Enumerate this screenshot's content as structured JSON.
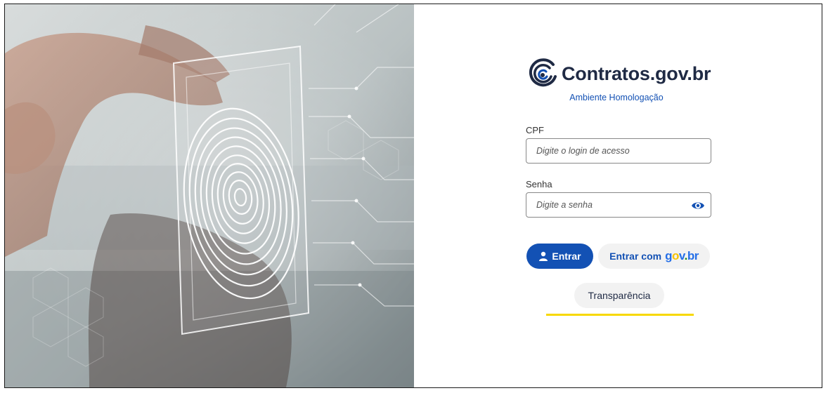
{
  "brand": {
    "name": "Contratos.gov.br",
    "environment": "Ambiente Homologação"
  },
  "form": {
    "cpf": {
      "label": "CPF",
      "placeholder": "Digite o login de acesso",
      "value": ""
    },
    "senha": {
      "label": "Senha",
      "placeholder": "Digite a senha",
      "value": ""
    }
  },
  "actions": {
    "entrar_label": "Entrar",
    "govbr_prefix": "Entrar com",
    "govbr_logo": {
      "g": "g",
      "o": "o",
      "v": "v",
      "dot": ".",
      "br": "br"
    },
    "transparencia_label": "Transparência"
  },
  "colors": {
    "primary": "#1351b4",
    "brand_dark": "#1f2a44",
    "accent_yellow": "#f8d800",
    "govbr_blue": "#2670e8",
    "govbr_yellow": "#f8c300",
    "govbr_green": "#168821"
  },
  "icons": {
    "logo": "contratos-spiral-icon",
    "password_toggle": "eye-icon",
    "entrar": "user-icon",
    "hero": "fingerprint-scan-image"
  }
}
